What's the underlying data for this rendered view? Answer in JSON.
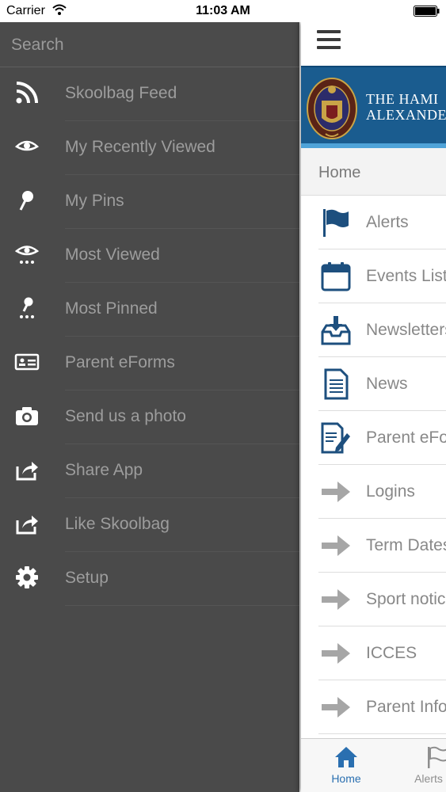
{
  "status": {
    "carrier": "Carrier",
    "time": "11:03 AM"
  },
  "menu": {
    "search_placeholder": "Search",
    "items": [
      {
        "label": "Skoolbag Feed",
        "icon": "rss-icon"
      },
      {
        "label": "My Recently Viewed",
        "icon": "eye-icon"
      },
      {
        "label": "My Pins",
        "icon": "pin-icon"
      },
      {
        "label": "Most Viewed",
        "icon": "eye-dots-icon"
      },
      {
        "label": "Most Pinned",
        "icon": "pin-dots-icon"
      },
      {
        "label": "Parent eForms",
        "icon": "id-card-icon"
      },
      {
        "label": "Send us a photo",
        "icon": "camera-icon"
      },
      {
        "label": "Share App",
        "icon": "share-icon"
      },
      {
        "label": "Like Skoolbag",
        "icon": "share-icon"
      },
      {
        "label": "Setup",
        "icon": "gear-icon"
      }
    ]
  },
  "main": {
    "banner_text_line1": "THE HAMI",
    "banner_text_line2": "ALEXANDE",
    "breadcrumb": "Home",
    "items": [
      {
        "label": "Alerts",
        "icon": "flag-icon"
      },
      {
        "label": "Events List",
        "icon": "calendar-icon"
      },
      {
        "label": "Newsletters",
        "icon": "inbox-download-icon"
      },
      {
        "label": "News",
        "icon": "document-icon"
      },
      {
        "label": "Parent eForms",
        "icon": "form-edit-icon"
      },
      {
        "label": "Logins",
        "icon": "arrow-right-icon"
      },
      {
        "label": "Term Dates",
        "icon": "arrow-right-icon"
      },
      {
        "label": "Sport notices",
        "icon": "arrow-right-icon"
      },
      {
        "label": "ICCES",
        "icon": "arrow-right-icon"
      },
      {
        "label": "Parent Info",
        "icon": "arrow-right-icon"
      }
    ]
  },
  "tabs": [
    {
      "label": "Home",
      "icon": "home-icon",
      "selected": true
    },
    {
      "label": "Alerts",
      "icon": "flag-icon",
      "selected": false
    }
  ],
  "colors": {
    "menu_bg": "#4a4a4a",
    "menu_text": "#9d9d9d",
    "accent_blue": "#1a5c8f",
    "tab_active": "#2a6fb0",
    "tab_inactive": "#8e8e8e"
  }
}
